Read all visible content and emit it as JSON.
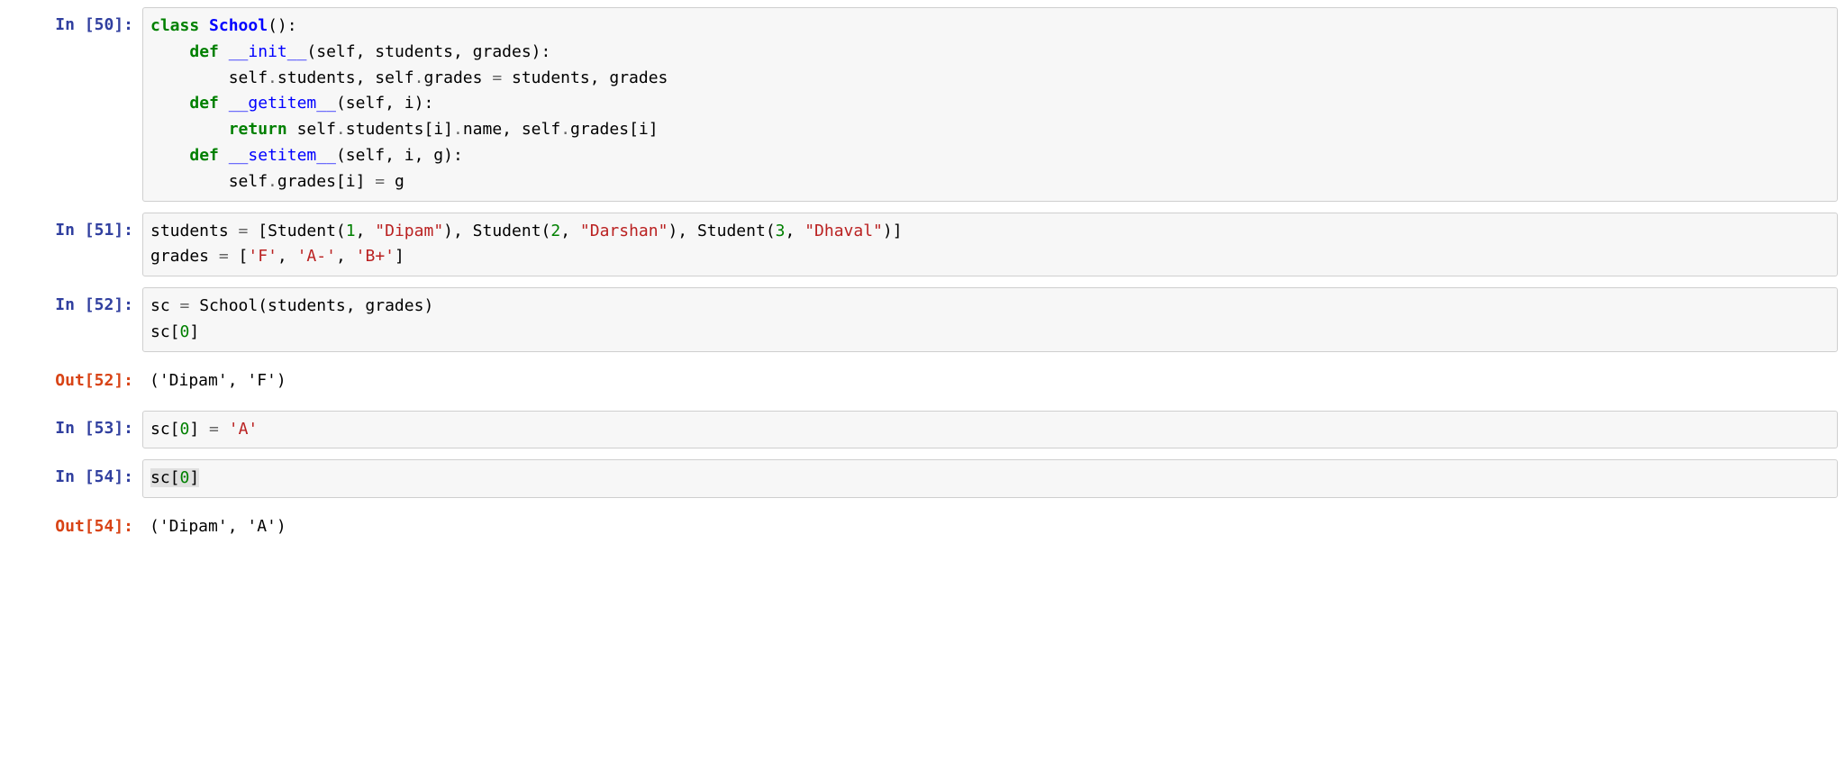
{
  "cells": [
    {
      "prompt_type": "in",
      "prompt_label": "In [50]:",
      "area_class": "input-area",
      "tokens": [
        {
          "t": "class",
          "c": "t-kw"
        },
        {
          "t": " "
        },
        {
          "t": "School",
          "c": "t-cls"
        },
        {
          "t": "():"
        },
        {
          "t": "\n"
        },
        {
          "t": "    "
        },
        {
          "t": "def",
          "c": "t-kw"
        },
        {
          "t": " "
        },
        {
          "t": "__init__",
          "c": "t-func"
        },
        {
          "t": "(self, students, grades):"
        },
        {
          "t": "\n"
        },
        {
          "t": "        self"
        },
        {
          "t": ".",
          "c": "t-op"
        },
        {
          "t": "students, self"
        },
        {
          "t": ".",
          "c": "t-op"
        },
        {
          "t": "grades "
        },
        {
          "t": "=",
          "c": "t-op"
        },
        {
          "t": " students, grades"
        },
        {
          "t": "\n"
        },
        {
          "t": "    "
        },
        {
          "t": "def",
          "c": "t-kw"
        },
        {
          "t": " "
        },
        {
          "t": "__getitem__",
          "c": "t-func"
        },
        {
          "t": "(self, i):"
        },
        {
          "t": "\n"
        },
        {
          "t": "        "
        },
        {
          "t": "return",
          "c": "t-kw"
        },
        {
          "t": " self"
        },
        {
          "t": ".",
          "c": "t-op"
        },
        {
          "t": "students[i]"
        },
        {
          "t": ".",
          "c": "t-op"
        },
        {
          "t": "name, self"
        },
        {
          "t": ".",
          "c": "t-op"
        },
        {
          "t": "grades[i]"
        },
        {
          "t": "\n"
        },
        {
          "t": "    "
        },
        {
          "t": "def",
          "c": "t-kw"
        },
        {
          "t": " "
        },
        {
          "t": "__setitem__",
          "c": "t-func"
        },
        {
          "t": "(self, i, g):"
        },
        {
          "t": "\n"
        },
        {
          "t": "        self"
        },
        {
          "t": ".",
          "c": "t-op"
        },
        {
          "t": "grades[i] "
        },
        {
          "t": "=",
          "c": "t-op"
        },
        {
          "t": " g"
        }
      ]
    },
    {
      "prompt_type": "in",
      "prompt_label": "In [51]:",
      "area_class": "input-area",
      "tokens": [
        {
          "t": "students "
        },
        {
          "t": "=",
          "c": "t-op"
        },
        {
          "t": " [Student("
        },
        {
          "t": "1",
          "c": "t-num"
        },
        {
          "t": ", "
        },
        {
          "t": "\"Dipam\"",
          "c": "t-str"
        },
        {
          "t": "), Student("
        },
        {
          "t": "2",
          "c": "t-num"
        },
        {
          "t": ", "
        },
        {
          "t": "\"Darshan\"",
          "c": "t-str"
        },
        {
          "t": "), Student("
        },
        {
          "t": "3",
          "c": "t-num"
        },
        {
          "t": ", "
        },
        {
          "t": "\"Dhaval\"",
          "c": "t-str"
        },
        {
          "t": ")]"
        },
        {
          "t": "\n"
        },
        {
          "t": "grades "
        },
        {
          "t": "=",
          "c": "t-op"
        },
        {
          "t": " ["
        },
        {
          "t": "'F'",
          "c": "t-str"
        },
        {
          "t": ", "
        },
        {
          "t": "'A-'",
          "c": "t-str"
        },
        {
          "t": ", "
        },
        {
          "t": "'B+'",
          "c": "t-str"
        },
        {
          "t": "]"
        }
      ]
    },
    {
      "prompt_type": "in",
      "prompt_label": "In [52]:",
      "area_class": "input-area",
      "tokens": [
        {
          "t": "sc "
        },
        {
          "t": "=",
          "c": "t-op"
        },
        {
          "t": " School(students, grades)"
        },
        {
          "t": "\n"
        },
        {
          "t": "sc["
        },
        {
          "t": "0",
          "c": "t-num"
        },
        {
          "t": "]"
        }
      ]
    },
    {
      "prompt_type": "out",
      "prompt_label": "Out[52]:",
      "area_class": "output-area",
      "tokens": [
        {
          "t": "('Dipam', 'F')"
        }
      ]
    },
    {
      "prompt_type": "in",
      "prompt_label": "In [53]:",
      "area_class": "input-area",
      "tokens": [
        {
          "t": "sc["
        },
        {
          "t": "0",
          "c": "t-num"
        },
        {
          "t": "] "
        },
        {
          "t": "=",
          "c": "t-op"
        },
        {
          "t": " "
        },
        {
          "t": "'A'",
          "c": "t-str"
        }
      ]
    },
    {
      "prompt_type": "in",
      "prompt_label": "In [54]:",
      "area_class": "input-area",
      "tokens": [
        {
          "t": "sc[",
          "c": "t-hl"
        },
        {
          "t": "0",
          "c": "t-num t-hl"
        },
        {
          "t": "]",
          "c": "t-hl"
        }
      ]
    },
    {
      "prompt_type": "out",
      "prompt_label": "Out[54]:",
      "area_class": "output-area",
      "tokens": [
        {
          "t": "('Dipam', 'A')"
        }
      ]
    }
  ]
}
